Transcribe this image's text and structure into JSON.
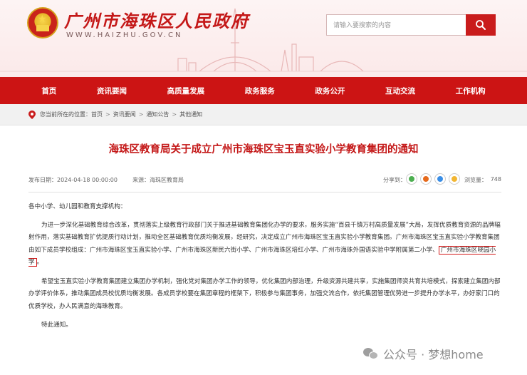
{
  "header": {
    "site_title": "广州市海珠区人民政府",
    "site_domain": "WWW.HAIZHU.GOV.CN",
    "search": {
      "placeholder": "请输入要搜索的内容"
    },
    "accent_color": "#cc1414"
  },
  "nav": {
    "items": [
      "首页",
      "资讯要闻",
      "高质量发展",
      "政务服务",
      "政务公开",
      "互动交流",
      "工作机构"
    ]
  },
  "breadcrumb": {
    "prefix": "您当前所在的位置：",
    "items": [
      "首页",
      "资讯要闻",
      "通知公告",
      "其他通知"
    ],
    "separator": ">"
  },
  "article": {
    "title": "海珠区教育局关于成立广州市海珠区宝玉直实验小学教育集团的通知",
    "date_label": "发布日期：2024-04-18 00:00:00",
    "source_label": "来源：海珠区教育局",
    "share_label": "分享到：",
    "share_icons": [
      "wechat-icon",
      "weibo-icon",
      "qq-icon",
      "qzone-icon"
    ],
    "views_label": "浏览量：",
    "views_count": "748",
    "greeting": "各中小学、幼儿园和教育支撑机构：",
    "p1_a": "为进一步深化基础教育综合改革，贯彻落实上级教育行政部门关于推进基础教育集团化办学的要求，服务实施“百县千镇万村高质量发展”大局，发挥优质教育资源的品牌辐射作用，落实基础教育扩优提质行动计划，推动全区基础教育优质均衡发展，经研究，决定成立广州市海珠区宝玉直实验小学教育集团。广州市海珠区宝玉直实验小学教育集团由如下成员学校组成：广州市海珠区宝玉直实验小学、广州市海珠区新民六街小学、广州市海珠区培红小学、广州市海珠外国语实验中学附属第二小学、",
    "p1_highlight": "广州市海珠区晓园小学",
    "p1_end": "。",
    "p2": "希望宝玉直实验小学教育集团建立集团办学机制，强化党对集团办学工作的领导，优化集团内部治理，升级资源共建共享，实施集团师资共育共培模式，探索建立集团内部办学评价体系，推动集团成员校优质均衡发展。各成员学校要在集团章程的框架下，积极参与集团事务，加强交流合作，依托集团管理优势进一步提升办学水平，办好家门口的优质学校，办人民满意的海珠教育。",
    "closing": "特此通知。"
  },
  "watermark": {
    "text": "公众号 · 梦想home"
  }
}
